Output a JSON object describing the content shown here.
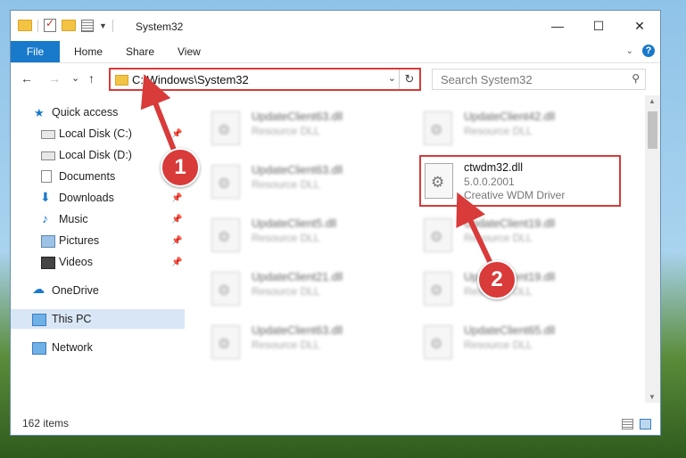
{
  "window": {
    "title": "System32"
  },
  "ribbon": {
    "file": "File",
    "home": "Home",
    "share": "Share",
    "view": "View",
    "help": "?"
  },
  "window_controls": {
    "minimize": "—",
    "maximize": "☐",
    "close": "✕"
  },
  "nav": {
    "back": "←",
    "forward": "→",
    "recent": "⌄",
    "up": "↑",
    "address": "C:\\Windows\\System32",
    "search_placeholder": "Search System32"
  },
  "sidebar": {
    "items": [
      {
        "label": "Quick access"
      },
      {
        "label": "Local Disk (C:)"
      },
      {
        "label": "Local Disk (D:)"
      },
      {
        "label": "Documents"
      },
      {
        "label": "Downloads"
      },
      {
        "label": "Music"
      },
      {
        "label": "Pictures"
      },
      {
        "label": "Videos"
      },
      {
        "label": "OneDrive"
      },
      {
        "label": "This PC"
      },
      {
        "label": "Network"
      }
    ]
  },
  "files": [
    {
      "name": "UpdateClient63.dll",
      "desc": "Resource DLL"
    },
    {
      "name": "UpdateClient42.dll",
      "desc": "Resource DLL"
    },
    {
      "name": "UpdateClient63.dll",
      "desc": "Resource DLL"
    },
    {
      "name": "UpdateClient5.dll",
      "desc": "Resource DLL"
    },
    {
      "name": "UpdateClient19.dll",
      "desc": "Resource DLL"
    },
    {
      "name": "UpdateClient21.dll",
      "desc": "Resource DLL"
    },
    {
      "name": "UpdateClient19.dll",
      "desc": "Resource DLL"
    },
    {
      "name": "UpdateClient63.dll",
      "desc": "Resource DLL"
    },
    {
      "name": "UpdateClient65.dll",
      "desc": "Resource DLL"
    }
  ],
  "highlighted_file": {
    "name": "ctwdm32.dll",
    "version": "5.0.0.2001",
    "desc": "Creative WDM Driver"
  },
  "status": {
    "item_count": "162 items"
  },
  "markers": {
    "one": "1",
    "two": "2"
  },
  "colors": {
    "accent": "#1979ca",
    "highlight": "#d93a3a"
  }
}
